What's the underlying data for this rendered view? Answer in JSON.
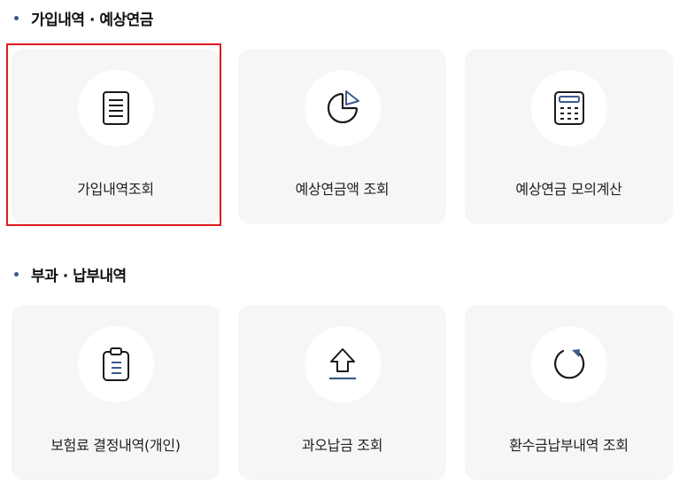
{
  "sections": [
    {
      "title": "가입내역 · 예상연금",
      "cards": [
        {
          "label": "가입내역조회",
          "icon": "document-icon"
        },
        {
          "label": "예상연금액 조회",
          "icon": "pie-chart-icon"
        },
        {
          "label": "예상연금 모의계산",
          "icon": "calculator-icon"
        }
      ]
    },
    {
      "title": "부과 · 납부내역",
      "cards": [
        {
          "label": "보험료 결정내역(개인)",
          "icon": "clipboard-icon"
        },
        {
          "label": "과오납금 조회",
          "icon": "upload-arrow-icon"
        },
        {
          "label": "환수금납부내역 조회",
          "icon": "refresh-icon"
        }
      ]
    }
  ],
  "colors": {
    "accent": "#3d5a8a",
    "highlight": "#e01b1b",
    "card_bg": "#f6f6f6"
  }
}
